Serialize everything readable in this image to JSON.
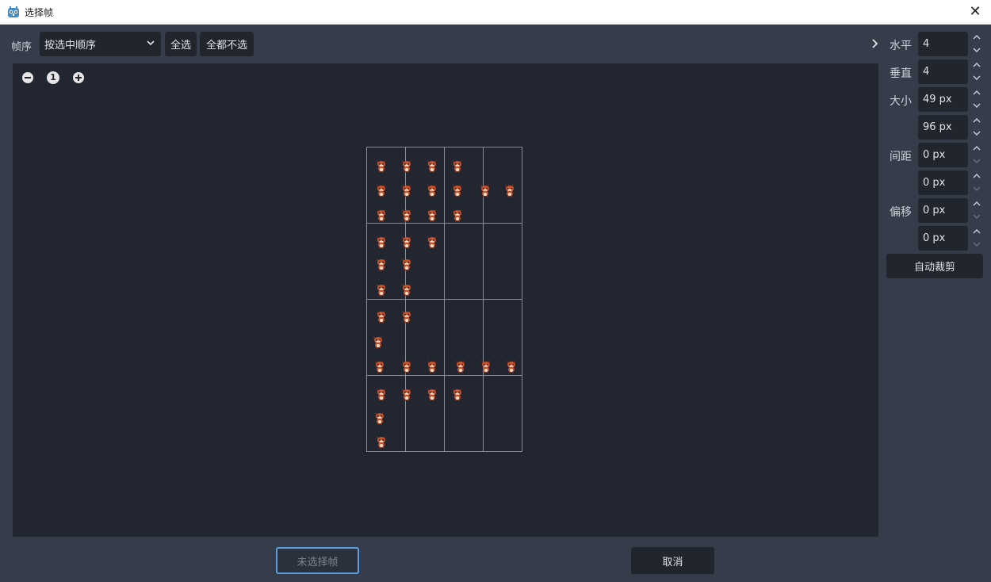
{
  "window": {
    "title": "选择帧"
  },
  "toolbar": {
    "order_label": "帧序",
    "order_selected": "按选中顺序",
    "select_all": "全选",
    "select_none": "全都不选"
  },
  "zoom": {
    "reset_label": "1"
  },
  "settings": {
    "horizontal_label": "水平",
    "horizontal_value": "4",
    "vertical_label": "垂直",
    "vertical_value": "4",
    "size_label": "大小",
    "size_x": "49 px",
    "size_y": "96 px",
    "separation_label": "间距",
    "separation_x": "0 px",
    "separation_y": "0 px",
    "offset_label": "偏移",
    "offset_x": "0 px",
    "offset_y": "0 px",
    "auto_slice": "自动裁剪"
  },
  "footer": {
    "add_frames": "未选择帧",
    "cancel": "取消"
  },
  "colors": {
    "accent": "#5aa0e0",
    "sprite_body": "#c4532c",
    "sprite_dark": "#7a2d1a",
    "sprite_light": "#f3e3cf"
  }
}
